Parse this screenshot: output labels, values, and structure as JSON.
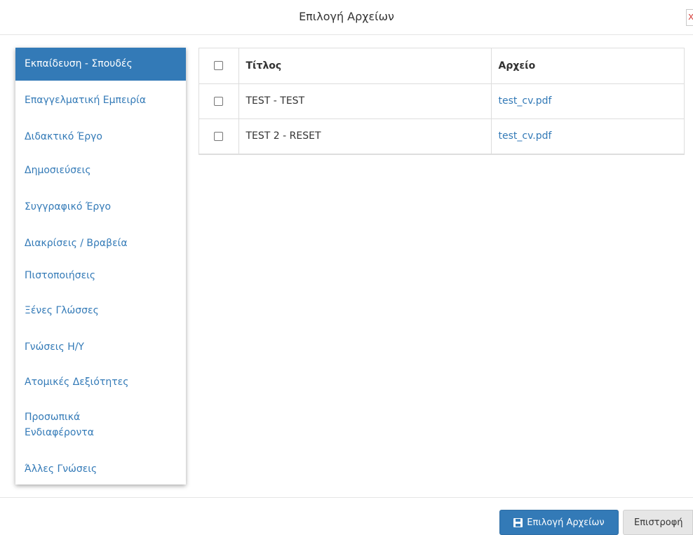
{
  "modal": {
    "title": "Επιλογή Αρχείων",
    "close_label": "x"
  },
  "sidebar": {
    "items": [
      {
        "label": "Εκπαίδευση - Σπουδές",
        "active": true
      },
      {
        "label": "Επαγγελματική Εμπειρία"
      },
      {
        "label": "Διδακτικό Έργο"
      },
      {
        "label": "Δημοσιεύσεις"
      },
      {
        "label": "Συγγραφικό Έργο"
      },
      {
        "label": "Διακρίσεις / Βραβεία"
      },
      {
        "label": "Πιστοποιήσεις"
      },
      {
        "label": "Ξένες Γλώσσες"
      },
      {
        "label": "Γνώσεις Η/Υ"
      },
      {
        "label": "Ατομικές Δεξιότητες"
      },
      {
        "label": "Προσωπικά Ενδιαφέροντα"
      },
      {
        "label": "Άλλες Γνώσεις"
      }
    ]
  },
  "table": {
    "headers": {
      "title": "Τίτλος",
      "file": "Αρχείο"
    },
    "rows": [
      {
        "title": "TEST - TEST",
        "file": "test_cv.pdf"
      },
      {
        "title": "TEST 2 - RESET",
        "file": "test_cv.pdf"
      }
    ]
  },
  "footer": {
    "select_label": "Επιλογή Αρχείων",
    "back_label": "Επιστροφή"
  },
  "colors": {
    "primary": "#337ab7",
    "close": "#d9534f"
  },
  "icons": {
    "select_button": "floppy-disk-icon"
  }
}
